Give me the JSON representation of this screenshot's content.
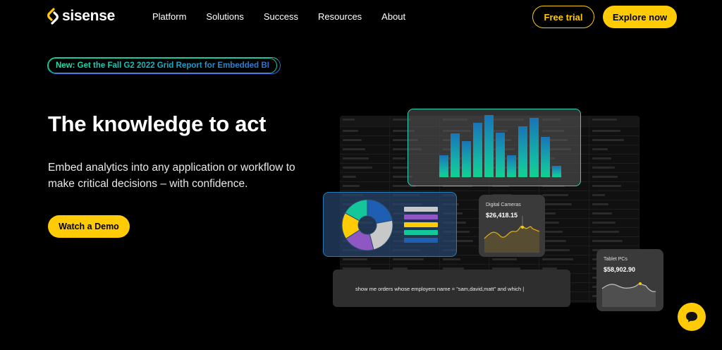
{
  "brand": {
    "name": "sisense",
    "accent": "#ffcb05"
  },
  "nav": {
    "links": [
      "Platform",
      "Solutions",
      "Success",
      "Resources",
      "About"
    ],
    "free_trial": "Free trial",
    "explore_now": "Explore now"
  },
  "hero": {
    "badge": "New: Get the Fall G2 2022 Grid Report for Embedded BI",
    "title": "The knowledge to act",
    "subtitle": "Embed analytics into any application or workflow to make critical decisions – with confidence.",
    "cta": "Watch a Demo"
  },
  "illustration": {
    "bar_chart": {
      "values": [
        35,
        70,
        58,
        88,
        100,
        72,
        35,
        82,
        95,
        65,
        18
      ]
    },
    "pie_colors": [
      "#1e5fb4",
      "#c8c8c8",
      "#8e57c4",
      "#ffcb05",
      "#14c79a"
    ],
    "legend_colors": [
      "#c8c8c8",
      "#8e57c4",
      "#ffcb05",
      "#14c79a",
      "#1e5fb4"
    ],
    "card1": {
      "label": "Digital Cameras",
      "value": "$26,418.15"
    },
    "card2": {
      "label": "Tablet PCs",
      "value": "$58,902.90"
    },
    "query": "show me orders whose employers name = \"sam,david,matt\" and which |"
  },
  "chat": {
    "icon": "chat-bubble-icon"
  }
}
